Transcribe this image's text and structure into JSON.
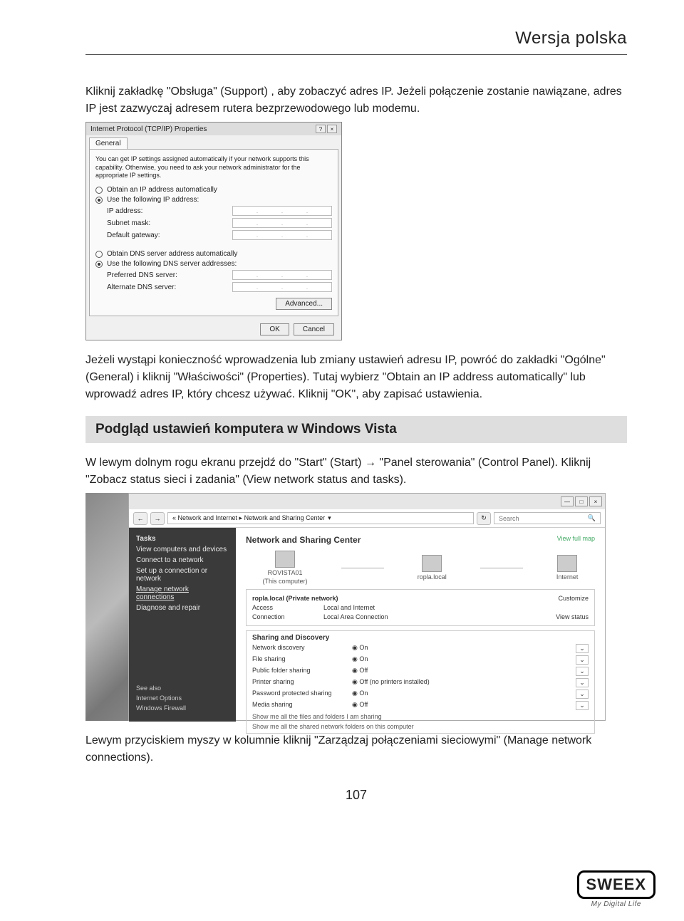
{
  "header": {
    "title": "Wersja polska"
  },
  "intro_para": "Kliknij zakładkę \"Obsługa\" (Support) , aby zobaczyć adres IP. Jeżeli połączenie zostanie nawiązane, adres IP jest zazwyczaj adresem rutera bezprzewodowego lub modemu.",
  "dialog1": {
    "title": "Internet Protocol (TCP/IP) Properties",
    "help_icon": "?",
    "close_icon": "×",
    "tab": "General",
    "intro": "You can get IP settings assigned automatically if your network supports this capability. Otherwise, you need to ask your network administrator for the appropriate IP settings.",
    "radio_ip_auto": "Obtain an IP address automatically",
    "radio_ip_manual": "Use the following IP address:",
    "ip_label": "IP address:",
    "subnet_label": "Subnet mask:",
    "gateway_label": "Default gateway:",
    "radio_dns_auto": "Obtain DNS server address automatically",
    "radio_dns_manual": "Use the following DNS server addresses:",
    "pref_dns": "Preferred DNS server:",
    "alt_dns": "Alternate DNS server:",
    "adv_btn": "Advanced...",
    "ok_btn": "OK",
    "cancel_btn": "Cancel"
  },
  "mid_para": "Jeżeli wystąpi konieczność wprowadzenia lub zmiany ustawień adresu IP, powróć do zakładki \"Ogólne\" (General) i kliknij \"Właściwości\" (Properties). Tutaj wybierz \"Obtain an IP address automatically\" lub wprowadź adres IP, który chcesz używać. Kliknij \"OK\", aby zapisać ustawienia.",
  "heading": "Podgląd ustawień komputera w Windows Vista",
  "vista_para": "W lewym dolnym rogu ekranu przejdź do \"Start\" (Start) → \"Panel sterowania\" (Control Panel). Kliknij \"Zobacz status sieci i zadania\" (View network status and tasks).",
  "vista": {
    "wc_min": "—",
    "wc_max": "□",
    "wc_close": "×",
    "nav_back": "←",
    "nav_fwd": "→",
    "crumb": "« Network and Internet ▸ Network and Sharing Center",
    "crumb_drop": "▾",
    "refresh": "↻",
    "search_placeholder": "Search",
    "search_icon": "🔍",
    "side_header": "Tasks",
    "side_items": [
      "View computers and devices",
      "Connect to a network",
      "Set up a connection or network",
      "Manage network connections",
      "Diagnose and repair"
    ],
    "side_selected_index": 3,
    "side_bottom": [
      "See also",
      "Internet Options",
      "Windows Firewall"
    ],
    "main_title": "Network and Sharing Center",
    "view_full_map": "View full map",
    "node1": "ROVISTA01",
    "node1_sub": "(This computer)",
    "node2": "ropla.local",
    "node3": "Internet",
    "netbox_title": "ropla.local (Private network)",
    "customize": "Customize",
    "access_label": "Access",
    "access_val": "Local and Internet",
    "conn_label": "Connection",
    "conn_val": "Local Area Connection",
    "view_status": "View status",
    "sharing_title": "Sharing and Discovery",
    "rows": [
      {
        "label": "Network discovery",
        "val": "On"
      },
      {
        "label": "File sharing",
        "val": "On"
      },
      {
        "label": "Public folder sharing",
        "val": "Off"
      },
      {
        "label": "Printer sharing",
        "val": "Off (no printers installed)"
      },
      {
        "label": "Password protected sharing",
        "val": "On"
      },
      {
        "label": "Media sharing",
        "val": "Off"
      }
    ],
    "bullet": "◉",
    "chev": "⌄",
    "foot1": "Show me all the files and folders I am sharing",
    "foot2": "Show me all the shared network folders on this computer"
  },
  "end_para": "Lewym przyciskiem myszy w kolumnie kliknij \"Zarządzaj połączeniami sieciowymi\" (Manage network connections).",
  "page_number": "107",
  "logo": {
    "brand": "SWEEX",
    "tagline": "My Digital Life"
  }
}
